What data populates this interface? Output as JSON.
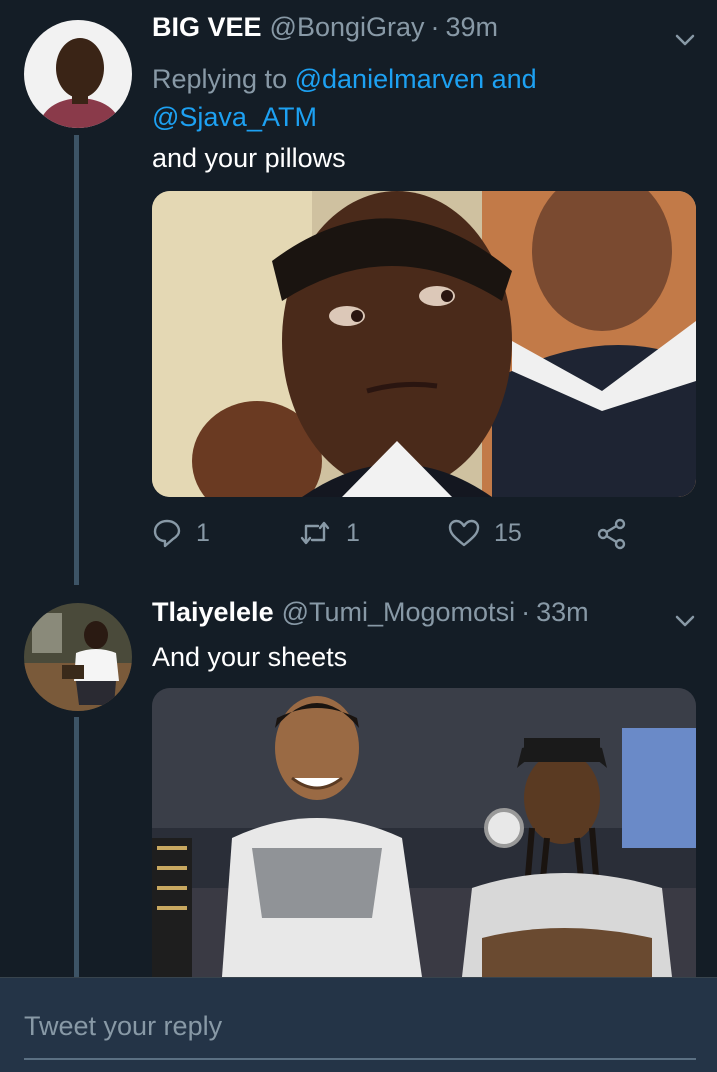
{
  "tweets": [
    {
      "name": "BIG VEE",
      "handle": "@BongiGray",
      "time": "39m",
      "reply_prefix": "Replying to",
      "reply_mention_1": "@danielmarven",
      "reply_and": "and",
      "reply_mention_2": "@Sjava_ATM",
      "text": "and your pillows",
      "media_icon": "photo-man-side-eye",
      "stats": {
        "replies": "1",
        "retweets": "1",
        "likes": "15"
      }
    },
    {
      "name": "Tlaiyelele",
      "handle": "@Tumi_Mogomotsi",
      "time": "33m",
      "text": "And your sheets",
      "media_icon": "photo-two-men-courtside"
    }
  ],
  "composer": {
    "placeholder": "Tweet your reply"
  },
  "colors": {
    "background": "#141d26",
    "composer_bg": "#243447",
    "secondary_text": "#8899a6",
    "link": "#1da1f2",
    "thread_line": "#3d5466"
  },
  "icons": [
    "chevron-down-icon",
    "reply-icon",
    "retweet-icon",
    "like-icon",
    "share-icon"
  ]
}
